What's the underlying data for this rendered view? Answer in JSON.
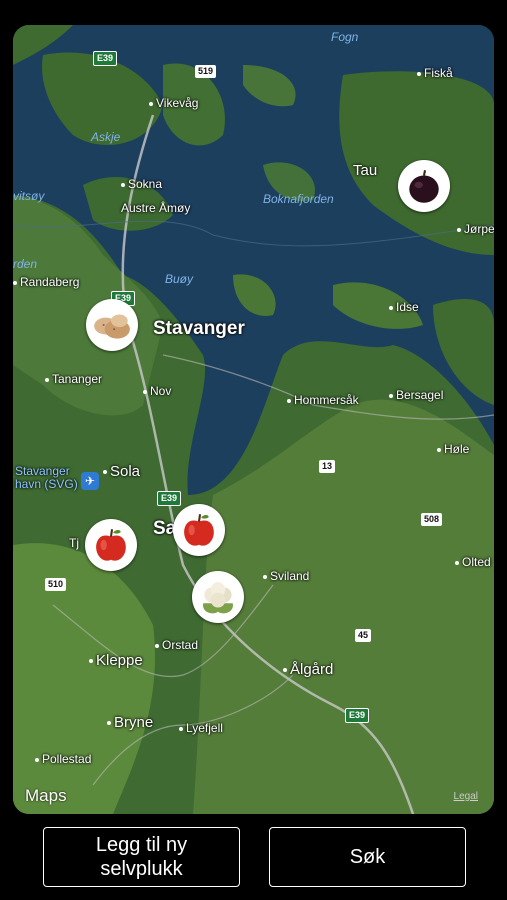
{
  "map": {
    "attribution": "Maps",
    "legal": "Legal",
    "places": {
      "fogn": "Fogn",
      "fiska": "Fiskå",
      "vikevag": "Vikevåg",
      "askje": "Askje",
      "sokna": "Sokna",
      "austre_amoy": "Austre Åmøy",
      "boknafjorden": "Boknafjorden",
      "tau": "Tau",
      "jorpe": "Jørpe",
      "vitsoy": "vitsøy",
      "rden": "rden",
      "randaberg": "Randaberg",
      "buoy": "Buøy",
      "stavanger": "Stavanger",
      "idse": "Idse",
      "tananger": "Tananger",
      "nov": "Nov",
      "hommersak": "Hommersåk",
      "bersagel": "Bersagel",
      "hole": "Høle",
      "stavanger_airport": "Stavanger\nhavn (SVG)",
      "sola": "Sola",
      "sa": "Sa",
      "tj": "Tj",
      "sviland": "Sviland",
      "olted": "Olted",
      "orstad": "Orstad",
      "kleppe": "Kleppe",
      "algard": "Ålgård",
      "bryne": "Bryne",
      "lyefjell": "Lyefjell",
      "pollestad": "Pollestad"
    },
    "shields": {
      "e39_top": "E39",
      "r519": "519",
      "e39_mid": "E39",
      "e39_sola": "E39",
      "r13": "13",
      "r508": "508",
      "r510": "510",
      "r45": "45",
      "e39_bottom": "E39"
    },
    "pins": [
      {
        "name": "plum",
        "icon": "plum-icon"
      },
      {
        "name": "potatoes",
        "icon": "potato-icon"
      },
      {
        "name": "apple-west",
        "icon": "apple-icon"
      },
      {
        "name": "apple-center",
        "icon": "apple-icon"
      },
      {
        "name": "cauliflower",
        "icon": "cauliflower-icon"
      }
    ]
  },
  "buttons": {
    "add_label": "Legg til ny\nselvplukk",
    "search_label": "Søk"
  }
}
